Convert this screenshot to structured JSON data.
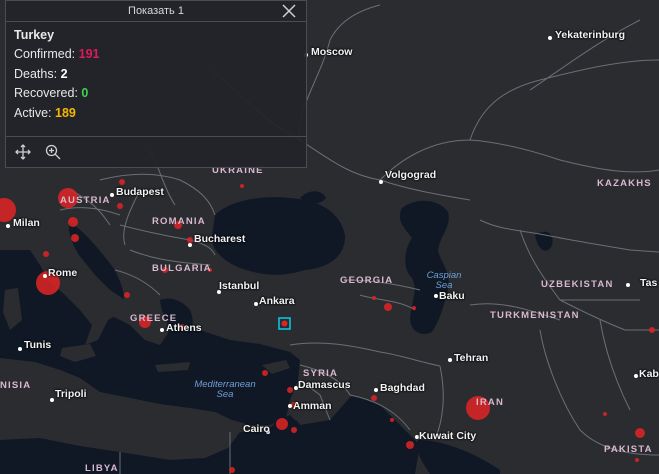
{
  "popup": {
    "title": "Показать 1",
    "country": "Turkey",
    "stats": [
      {
        "label": "Confirmed:",
        "value": "191",
        "color": "#e0195a"
      },
      {
        "label": "Deaths:",
        "value": "2",
        "color": "#ffffff"
      },
      {
        "label": "Recovered:",
        "value": "0",
        "color": "#39d353"
      },
      {
        "label": "Active:",
        "value": "189",
        "color": "#f5b800"
      }
    ],
    "tools": [
      "move-icon",
      "zoom-in-icon",
      "close-icon"
    ]
  },
  "map": {
    "cities": [
      "Moscow",
      "Yekaterinburg",
      "Volgograd",
      "Budapest",
      "Bucharest",
      "Milan",
      "Rome",
      "Istanbul",
      "Ankara",
      "Athens",
      "Tunis",
      "Tripoli",
      "Baku",
      "Tehran",
      "Damascus",
      "Amman",
      "Baghdad",
      "Cairo",
      "Kuwait City",
      "Kab",
      "Tas"
    ],
    "countries": [
      "UKRAINE",
      "KAZAKHS",
      "ROMANIA",
      "BULGARIA",
      "GREECE",
      "GEORGIA",
      "UZBEKISTAN",
      "TURKMENISTAN",
      "SYRIA",
      "IRAN",
      "PAKISTA",
      "LIBYA",
      "NISIA",
      "AUSTRIA"
    ],
    "seas": [
      {
        "line1": "Caspian",
        "line2": "Sea"
      },
      {
        "line1": "Mediterranean",
        "line2": "Sea"
      }
    ],
    "colors": {
      "water": "#101826",
      "land": "#2a2c30",
      "border": "#6b6f76",
      "marker": "#e02424",
      "selected": "#00c6e0"
    }
  }
}
